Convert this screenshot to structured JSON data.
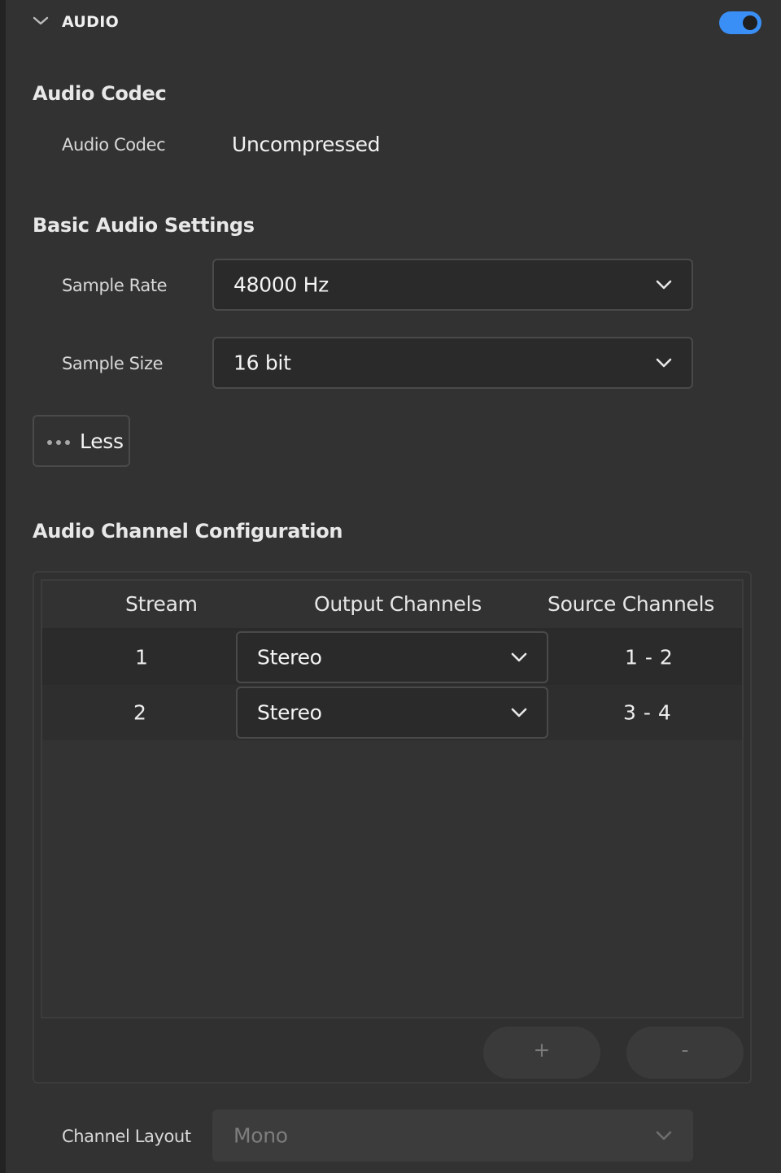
{
  "section": {
    "title": "AUDIO",
    "enabled": true,
    "toggle_color": "#3a8ff6"
  },
  "audio_codec": {
    "heading": "Audio Codec",
    "label": "Audio Codec",
    "value": "Uncompressed"
  },
  "basic": {
    "heading": "Basic Audio Settings",
    "sample_rate": {
      "label": "Sample Rate",
      "value": "48000 Hz"
    },
    "sample_size": {
      "label": "Sample Size",
      "value": "16 bit"
    },
    "less_button": {
      "label": "Less",
      "icon": "more-dots-icon"
    }
  },
  "channels": {
    "heading": "Audio Channel Configuration",
    "columns": [
      "Stream",
      "Output Channels",
      "Source Channels"
    ],
    "rows": [
      {
        "stream": "1",
        "output": "Stereo",
        "source": "1 - 2"
      },
      {
        "stream": "2",
        "output": "Stereo",
        "source": "3 - 4"
      }
    ],
    "add_label": "+",
    "remove_label": "-"
  },
  "channel_layout": {
    "label": "Channel Layout",
    "value": "Mono",
    "disabled": true
  }
}
